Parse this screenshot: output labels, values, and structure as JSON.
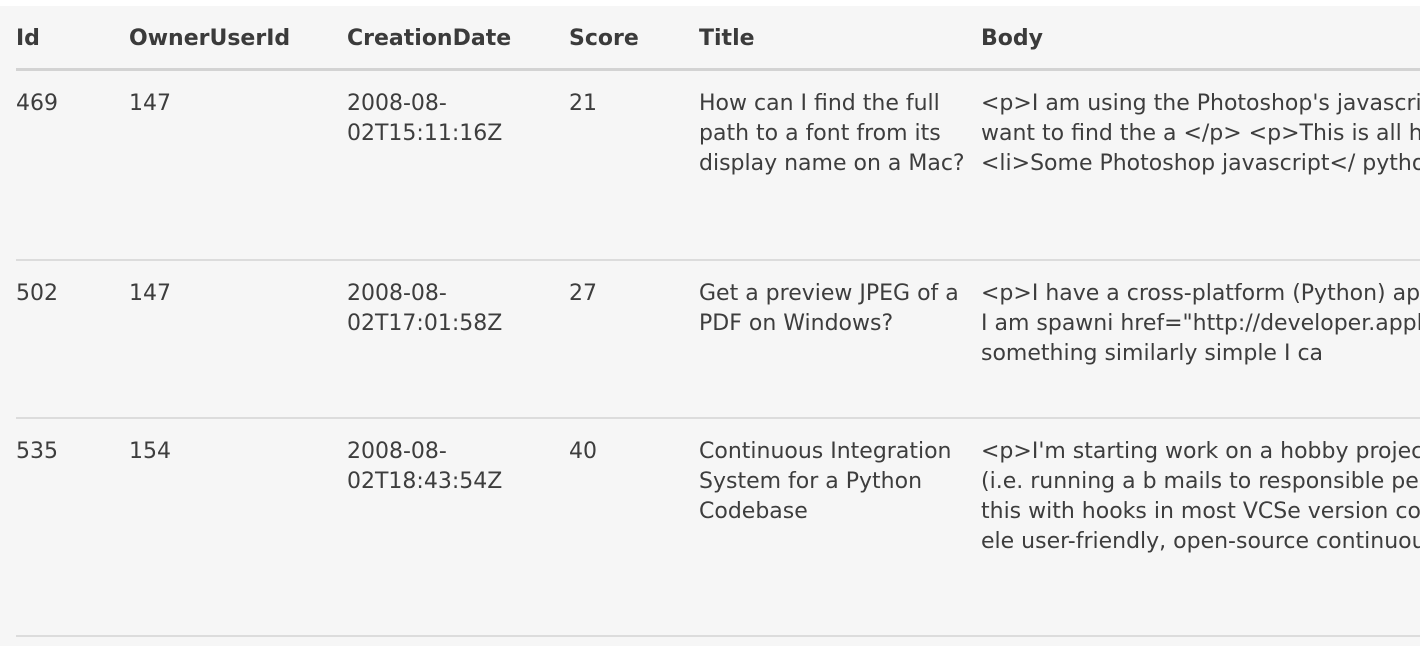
{
  "table": {
    "headers": [
      "Id",
      "OwnerUserId",
      "CreationDate",
      "Score",
      "Title",
      "Body"
    ],
    "rows": [
      {
        "id": "469",
        "owner": "147",
        "date": "2008-08-02T15:11:16Z",
        "score": "21",
        "title": "How can I find the full path to a font from its display name on a Mac?",
        "body": "<p>I am using the Photoshop's javascri returned by the API, I want to find the a </p> <p>This is all happening in a pyth <ul> <li>Some Photoshop javascript</ python</li> </ul>"
      },
      {
        "id": "502",
        "owner": "147",
        "date": "2008-08-02T17:01:58Z",
        "score": "27",
        "title": "Get a preview JPEG of a PDF on Windows?",
        "body": "<p>I have a cross-platform (Python) ap PDF.</p> <p>On the Mac I am spawni href=\"http://developer.apple.com/docu Is there something similarly simple I ca"
      },
      {
        "id": "535",
        "owner": "154",
        "date": "2008-08-02T18:43:54Z",
        "score": "40",
        "title": "Continuous Integration System for a Python Codebase",
        "body": "<p>I'm starting work on a hobby projec continuous integration (i.e. running a b mails to responsible persons when the could do this with hooks in most VCSe version control server, which isn't as ele user-friendly, open-source continuous i"
      }
    ]
  }
}
